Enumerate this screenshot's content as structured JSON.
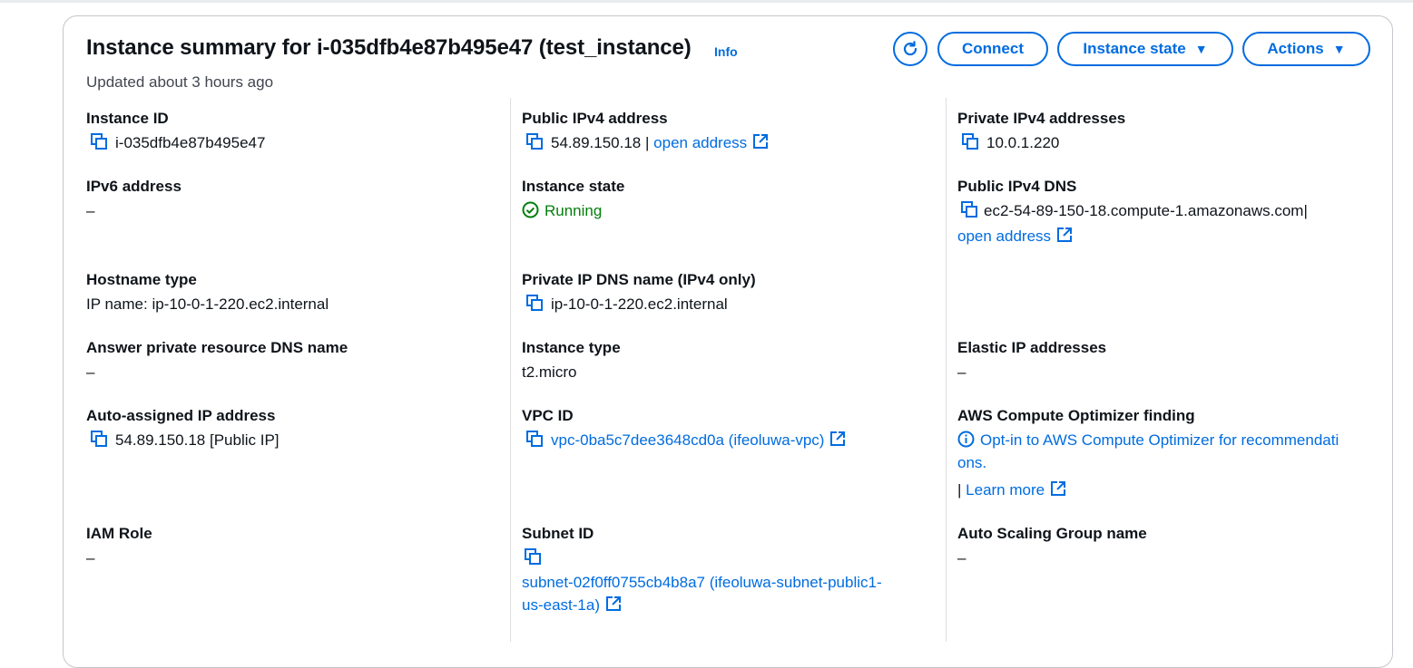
{
  "header": {
    "title": "Instance summary for i-035dfb4e87b495e47 (test_instance)",
    "info_link": "Info",
    "updated": "Updated about 3 hours ago",
    "buttons": {
      "connect": "Connect",
      "instance_state": "Instance state",
      "actions": "Actions"
    }
  },
  "fields": {
    "instance_id": {
      "label": "Instance ID",
      "value": "i-035dfb4e87b495e47"
    },
    "public_ipv4": {
      "label": "Public IPv4 address",
      "value": "54.89.150.18",
      "sep": "|",
      "link": "open address"
    },
    "private_ipv4": {
      "label": "Private IPv4 addresses",
      "value": "10.0.1.220"
    },
    "ipv6": {
      "label": "IPv6 address",
      "value": "–"
    },
    "instance_state": {
      "label": "Instance state",
      "value": "Running"
    },
    "public_dns": {
      "label": "Public IPv4 DNS",
      "value": "ec2-54-89-150-18.compute-1.amazonaws.com",
      "sep": "|",
      "link": "open address"
    },
    "hostname_type": {
      "label": "Hostname type",
      "value": "IP name: ip-10-0-1-220.ec2.internal"
    },
    "private_dns": {
      "label": "Private IP DNS name (IPv4 only)",
      "value": "ip-10-0-1-220.ec2.internal"
    },
    "answer_dns": {
      "label": "Answer private resource DNS name",
      "value": "–"
    },
    "instance_type": {
      "label": "Instance type",
      "value": "t2.micro"
    },
    "elastic_ip": {
      "label": "Elastic IP addresses",
      "value": "–"
    },
    "auto_ip": {
      "label": "Auto-assigned IP address",
      "value": "54.89.150.18 [Public IP]"
    },
    "vpc_id": {
      "label": "VPC ID",
      "value": "vpc-0ba5c7dee3648cd0a (ifeoluwa-vpc)"
    },
    "optimizer": {
      "label": "AWS Compute Optimizer finding",
      "line1": "Opt-in to AWS Compute Optimizer for recommendati",
      "line2": "ons.",
      "sep": "|",
      "link": "Learn more"
    },
    "iam_role": {
      "label": "IAM Role",
      "value": "–"
    },
    "subnet_id": {
      "label": "Subnet ID",
      "line1": "subnet-02f0ff0755cb4b8a7 (ifeoluwa-subnet-public1-",
      "line2": "us-east-1a)"
    },
    "asg_name": {
      "label": "Auto Scaling Group name",
      "value": "–"
    }
  },
  "colors": {
    "link": "#006ce0",
    "running": "#037f0c",
    "border": "#c6c6cd"
  },
  "icons": [
    "refresh-icon",
    "caret-down-icon",
    "copy-icon",
    "external-link-icon",
    "check-circle-icon",
    "info-circle-icon"
  ]
}
